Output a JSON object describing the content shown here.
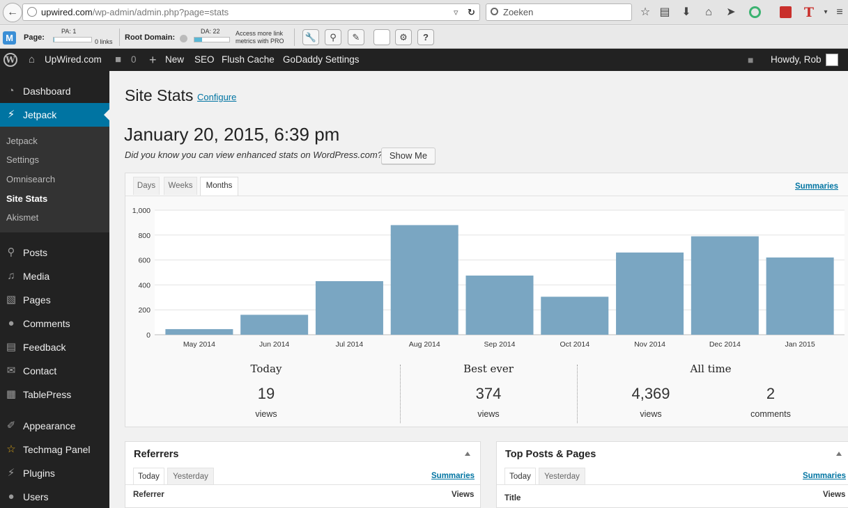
{
  "browser": {
    "url_host": "upwired.com",
    "url_path": "/wp-admin/admin.php?page=stats",
    "search_placeholder": "Zoeken",
    "colors": {
      "accent_green": "#3cb371",
      "accent_red": "#c9302c"
    }
  },
  "mozbar": {
    "page_label": "Page:",
    "pa_label": "PA: 1",
    "links_label": "0 links",
    "pa_level": 0.01,
    "root_domain_label": "Root Domain:",
    "da_label": "DA: 22",
    "da_level": 0.22,
    "pro_text_line1": "Access more link",
    "pro_text_line2": "metrics with PRO",
    "tools": [
      "wrench-icon",
      "search-icon",
      "pencil-icon",
      "blank-icon",
      "gear-icon",
      "help-icon"
    ]
  },
  "adminbar": {
    "site_name": "UpWired.com",
    "comments_count": "0",
    "new_label": "New",
    "seo_label": "SEO",
    "flush_cache_label": "Flush Cache",
    "godaddy_label": "GoDaddy Settings",
    "howdy_label": "Howdy, Rob"
  },
  "sidebar": {
    "items": [
      {
        "label": "Dashboard",
        "icon": "dashboard-icon"
      },
      {
        "label": "Jetpack",
        "icon": "jetpack-icon",
        "active": true
      },
      {
        "label": "Posts",
        "icon": "pin-icon"
      },
      {
        "label": "Media",
        "icon": "media-icon"
      },
      {
        "label": "Pages",
        "icon": "pages-icon"
      },
      {
        "label": "Comments",
        "icon": "comments-icon"
      },
      {
        "label": "Feedback",
        "icon": "feedback-icon"
      },
      {
        "label": "Contact",
        "icon": "envelope-icon"
      },
      {
        "label": "TablePress",
        "icon": "table-icon"
      },
      {
        "label": "Appearance",
        "icon": "brush-icon"
      },
      {
        "label": "Techmag Panel",
        "icon": "star-icon"
      },
      {
        "label": "Plugins",
        "icon": "plugin-icon"
      },
      {
        "label": "Users",
        "icon": "user-icon"
      }
    ],
    "submenu": [
      "Jetpack",
      "Settings",
      "Omnisearch",
      "Site Stats",
      "Akismet"
    ],
    "current_sub": "Site Stats"
  },
  "main": {
    "page_title": "Site Stats",
    "configure_link": "Configure",
    "date_heading": "January 20, 2015, 6:39 pm",
    "did_you_know": "Did you know you can view enhanced stats on WordPress.com?",
    "show_me_label": "Show Me",
    "tabs": [
      "Days",
      "Weeks",
      "Months"
    ],
    "active_tab": "Months",
    "summaries_label": "Summaries",
    "stats": {
      "today_title": "Today",
      "today_value": "19",
      "today_unit": "views",
      "best_title": "Best ever",
      "best_value": "374",
      "best_unit": "views",
      "alltime_title": "All time",
      "alltime_views": "4,369",
      "alltime_views_unit": "views",
      "alltime_comments": "2",
      "alltime_comments_unit": "comments"
    }
  },
  "chart_data": {
    "type": "bar",
    "categories": [
      "May 2014",
      "Jun 2014",
      "Jul 2014",
      "Aug 2014",
      "Sep 2014",
      "Oct 2014",
      "Nov 2014",
      "Dec 2014",
      "Jan 2015"
    ],
    "values": [
      45,
      160,
      430,
      880,
      475,
      305,
      660,
      790,
      620
    ],
    "ylim": [
      0,
      1000
    ],
    "yticks": [
      0,
      200,
      400,
      600,
      800,
      1000
    ],
    "ytick_labels": [
      "0",
      "200",
      "400",
      "600",
      "800",
      "1,000"
    ],
    "grid": true,
    "bar_color": "#7aa6c2"
  },
  "boxes": {
    "referrers": {
      "title": "Referrers",
      "tabs": [
        "Today",
        "Yesterday"
      ],
      "summaries_label": "Summaries",
      "col_left": "Referrer",
      "col_right": "Views"
    },
    "top_posts": {
      "title": "Top Posts & Pages",
      "tabs": [
        "Today",
        "Yesterday"
      ],
      "summaries_label": "Summaries",
      "col_left": "Title",
      "col_right": "Views"
    }
  }
}
